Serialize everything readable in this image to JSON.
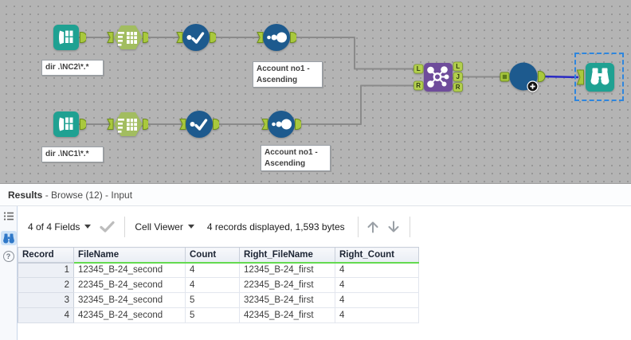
{
  "canvas": {
    "annotations": {
      "input_top": "dir .\\NC2\\*.*",
      "input_bottom": "dir .\\NC1\\*.*",
      "sort_top": "Account no1 - Ascending",
      "sort_bottom": "Account no1 - Ascending"
    },
    "join_ports": {
      "in": [
        "L",
        "R"
      ],
      "out": [
        "L",
        "J",
        "R"
      ]
    },
    "colors": {
      "canvas_bg": "#b4b4b4",
      "tool_teal": "#1fa192",
      "tool_green": "#a2bd60",
      "tool_blue": "#1d5a8e",
      "tool_purple": "#6f4c9b",
      "anchor_green": "#a9c83d",
      "wire_gray": "#8a8a8a",
      "wire_selected_blue": "#2a2ac4",
      "selection_dash_blue": "#2e86de"
    }
  },
  "results": {
    "title": "Results",
    "subtitle": " - Browse (12) - Input",
    "sidebar": {
      "help_glyph": "?"
    },
    "toolbar": {
      "fields_dropdown": "4 of 4 Fields",
      "cell_viewer_dropdown": "Cell Viewer",
      "records_info": "4 records displayed, 1,593 bytes"
    },
    "table": {
      "columns": [
        "Record",
        "FileName",
        "Count",
        "Right_FileName",
        "Right_Count"
      ],
      "rows": [
        [
          "1",
          "12345_B-24_second",
          "4",
          "12345_B-24_first",
          "4"
        ],
        [
          "2",
          "22345_B-24_second",
          "4",
          "22345_B-24_first",
          "4"
        ],
        [
          "3",
          "32345_B-24_second",
          "5",
          "32345_B-24_first",
          "4"
        ],
        [
          "4",
          "42345_B-24_second",
          "5",
          "42345_B-24_first",
          "4"
        ]
      ]
    }
  }
}
